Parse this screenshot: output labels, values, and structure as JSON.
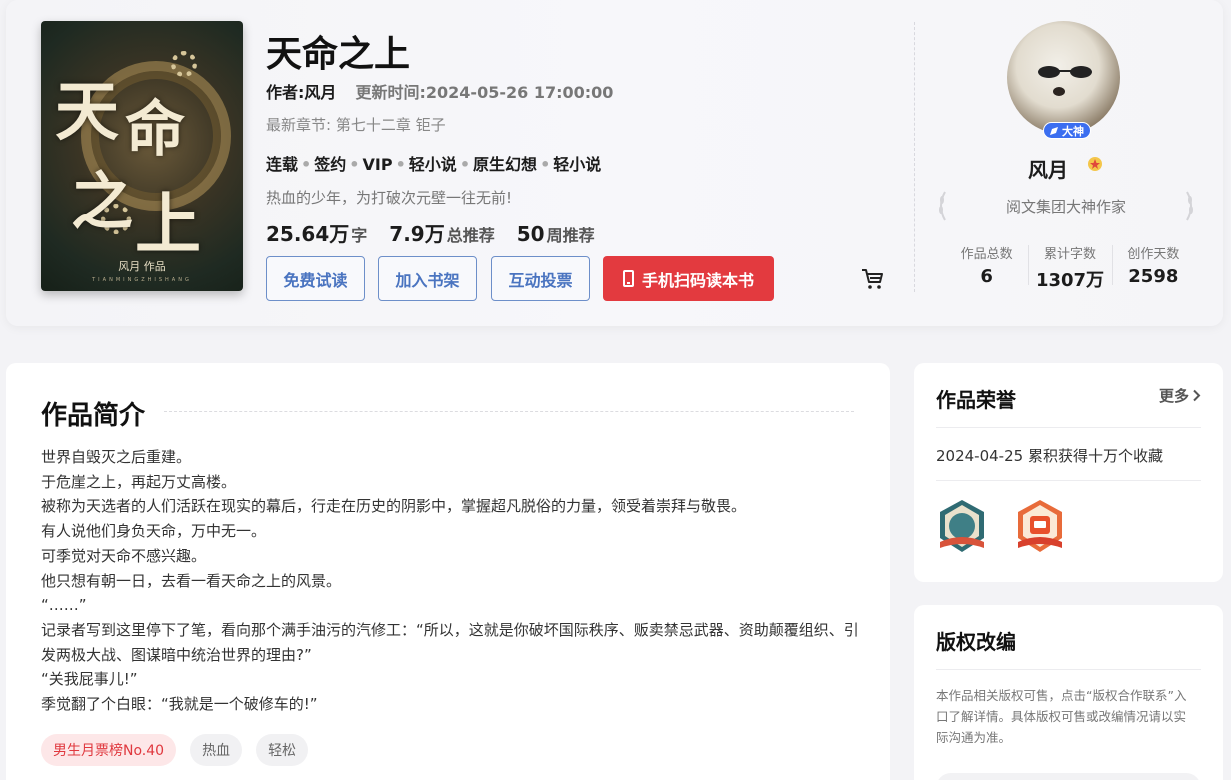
{
  "book": {
    "title": "天命之上",
    "author_label": "作者:风月",
    "update_label": "更新时间:2024-05-26 17:00:00",
    "latest_chapter": "最新章节: 第七十二章 钜子",
    "tags": [
      "连载",
      "签约",
      "VIP",
      "轻小说",
      "原生幻想",
      "轻小说"
    ],
    "slogan": "热血的少年，为打破次元壁一往无前!",
    "stats": [
      {
        "num": "25.64万",
        "unit": "字"
      },
      {
        "num": "7.9万",
        "unit": "总推荐"
      },
      {
        "num": "50",
        "unit": "周推荐"
      }
    ],
    "cover": {
      "chars": [
        "天",
        "命",
        "之",
        "上"
      ],
      "author_mark": "风月 作品",
      "pinyin": "TIANMINGZHISHANG"
    }
  },
  "actions": {
    "free_read": "免费试读",
    "add_shelf": "加入书架",
    "vote": "互动投票",
    "scan_read": "手机扫码读本书"
  },
  "author": {
    "badge": "大神",
    "name": "风月",
    "title": "阅文集团大神作家",
    "stats": [
      {
        "label": "作品总数",
        "value": "6"
      },
      {
        "label": "累计字数",
        "value": "1307万"
      },
      {
        "label": "创作天数",
        "value": "2598"
      }
    ]
  },
  "intro": {
    "title": "作品简介",
    "paragraphs": [
      "世界自毁灭之后重建。",
      "于危崖之上，再起万丈高楼。",
      "被称为天选者的人们活跃在现实的幕后，行走在历史的阴影中，掌握超凡脱俗的力量，领受着崇拜与敬畏。",
      "有人说他们身负天命，万中无一。",
      "可季觉对天命不感兴趣。",
      "他只想有朝一日，去看一看天命之上的风景。",
      "“……”",
      "记录者写到这里停下了笔，看向那个满手油污的汽修工：“所以，这就是你破坏国际秩序、贩卖禁忌武器、资助颠覆组织、引发两极大战、图谋暗中统治世界的理由?”",
      "“关我屁事儿!”",
      "季觉翻了个白眼：“我就是一个破修车的!”"
    ],
    "chips": [
      "男生月票榜No.40",
      "热血",
      "轻松"
    ]
  },
  "honor": {
    "title": "作品荣誉",
    "more": "更多",
    "item": "2024-04-25 累积获得十万个收藏"
  },
  "copyright": {
    "title": "版权改编",
    "text": "本作品相关版权可售，点击“版权合作联系”入口了解详情。具体版权可售或改编情况请以实际沟通为准。"
  },
  "colors": {
    "accent_red": "#e33a3f",
    "link_blue": "#4a74c0",
    "badge_blue": "#3b6ef0"
  }
}
